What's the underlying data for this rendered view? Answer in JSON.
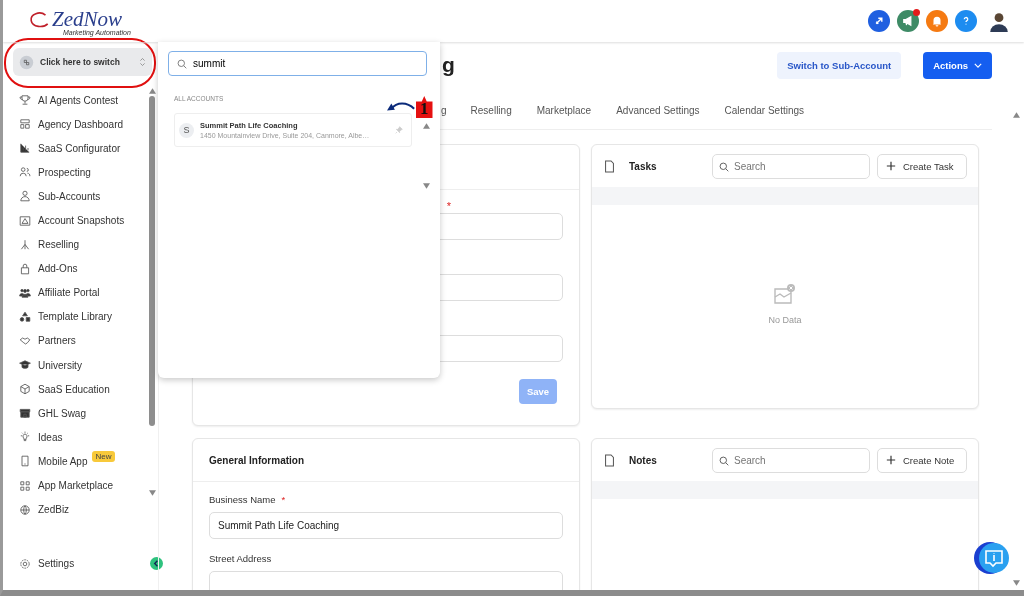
{
  "logo": {
    "name": "ZedNow",
    "tagline": "Marketing Automation"
  },
  "account_switcher": {
    "label": "Click here to switch"
  },
  "sidebar": {
    "items": [
      {
        "label": "AI Agents Contest"
      },
      {
        "label": "Agency Dashboard"
      },
      {
        "label": "SaaS Configurator"
      },
      {
        "label": "Prospecting"
      },
      {
        "label": "Sub-Accounts"
      },
      {
        "label": "Account Snapshots"
      },
      {
        "label": "Reselling"
      },
      {
        "label": "Add-Ons"
      },
      {
        "label": "Affiliate Portal"
      },
      {
        "label": "Template Library"
      },
      {
        "label": "Partners"
      },
      {
        "label": "University"
      },
      {
        "label": "SaaS Education"
      },
      {
        "label": "GHL Swag"
      },
      {
        "label": "Ideas"
      },
      {
        "label": "Mobile App",
        "badge": "New"
      },
      {
        "label": "App Marketplace"
      },
      {
        "label": "ZedBiz"
      }
    ],
    "settings": "Settings"
  },
  "switcher_dropdown": {
    "search_value": "summit",
    "section": "ALL ACCOUNTS",
    "accounts": [
      {
        "initial": "S",
        "name": "Summit Path Life Coaching",
        "address": "1450 Mountainview Drive, Suite 204, Canmore, Albe…"
      }
    ]
  },
  "annotation": {
    "step": "1"
  },
  "header": {
    "title": "g",
    "buttons": [
      "Switch to Sub-Account",
      "Actions"
    ]
  },
  "tabs": [
    {
      "label": "g",
      "selected": false
    },
    {
      "label": "Reselling",
      "selected": false
    },
    {
      "label": "Marketplace",
      "selected": false
    },
    {
      "label": "Advanced Settings",
      "selected": false
    },
    {
      "label": "Calendar Settings",
      "selected": false
    }
  ],
  "company_card": {
    "required_mark": "*",
    "save": "Save"
  },
  "tasks": {
    "title": "Tasks",
    "search_placeholder": "Search",
    "create": "Create Task",
    "empty": "No Data"
  },
  "general_information": {
    "title": "General Information",
    "fields": [
      {
        "label": "Business Name",
        "required": true,
        "value": "Summit Path Life Coaching"
      },
      {
        "label": "Street Address",
        "required": false
      }
    ],
    "required_mark": "*"
  },
  "notes": {
    "title": "Notes",
    "search_placeholder": "Search",
    "create": "Create Note"
  }
}
